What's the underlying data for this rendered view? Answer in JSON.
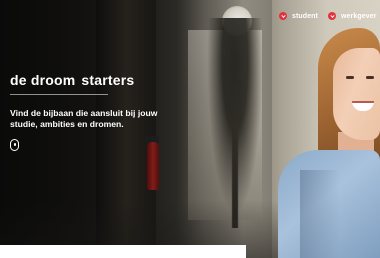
{
  "nav": {
    "items": [
      {
        "label": "student",
        "icon": "chevron-down-icon"
      },
      {
        "label": "werkgever",
        "icon": "chevron-down-icon"
      }
    ],
    "accent_color": "#e2323c"
  },
  "brand": {
    "word1": "de droom",
    "word2": "starters"
  },
  "hero": {
    "tagline": "Vind de bijbaan die aansluit bij jouw studie, ambities en dromen.",
    "scroll_icon": "mouse-scroll-icon"
  }
}
